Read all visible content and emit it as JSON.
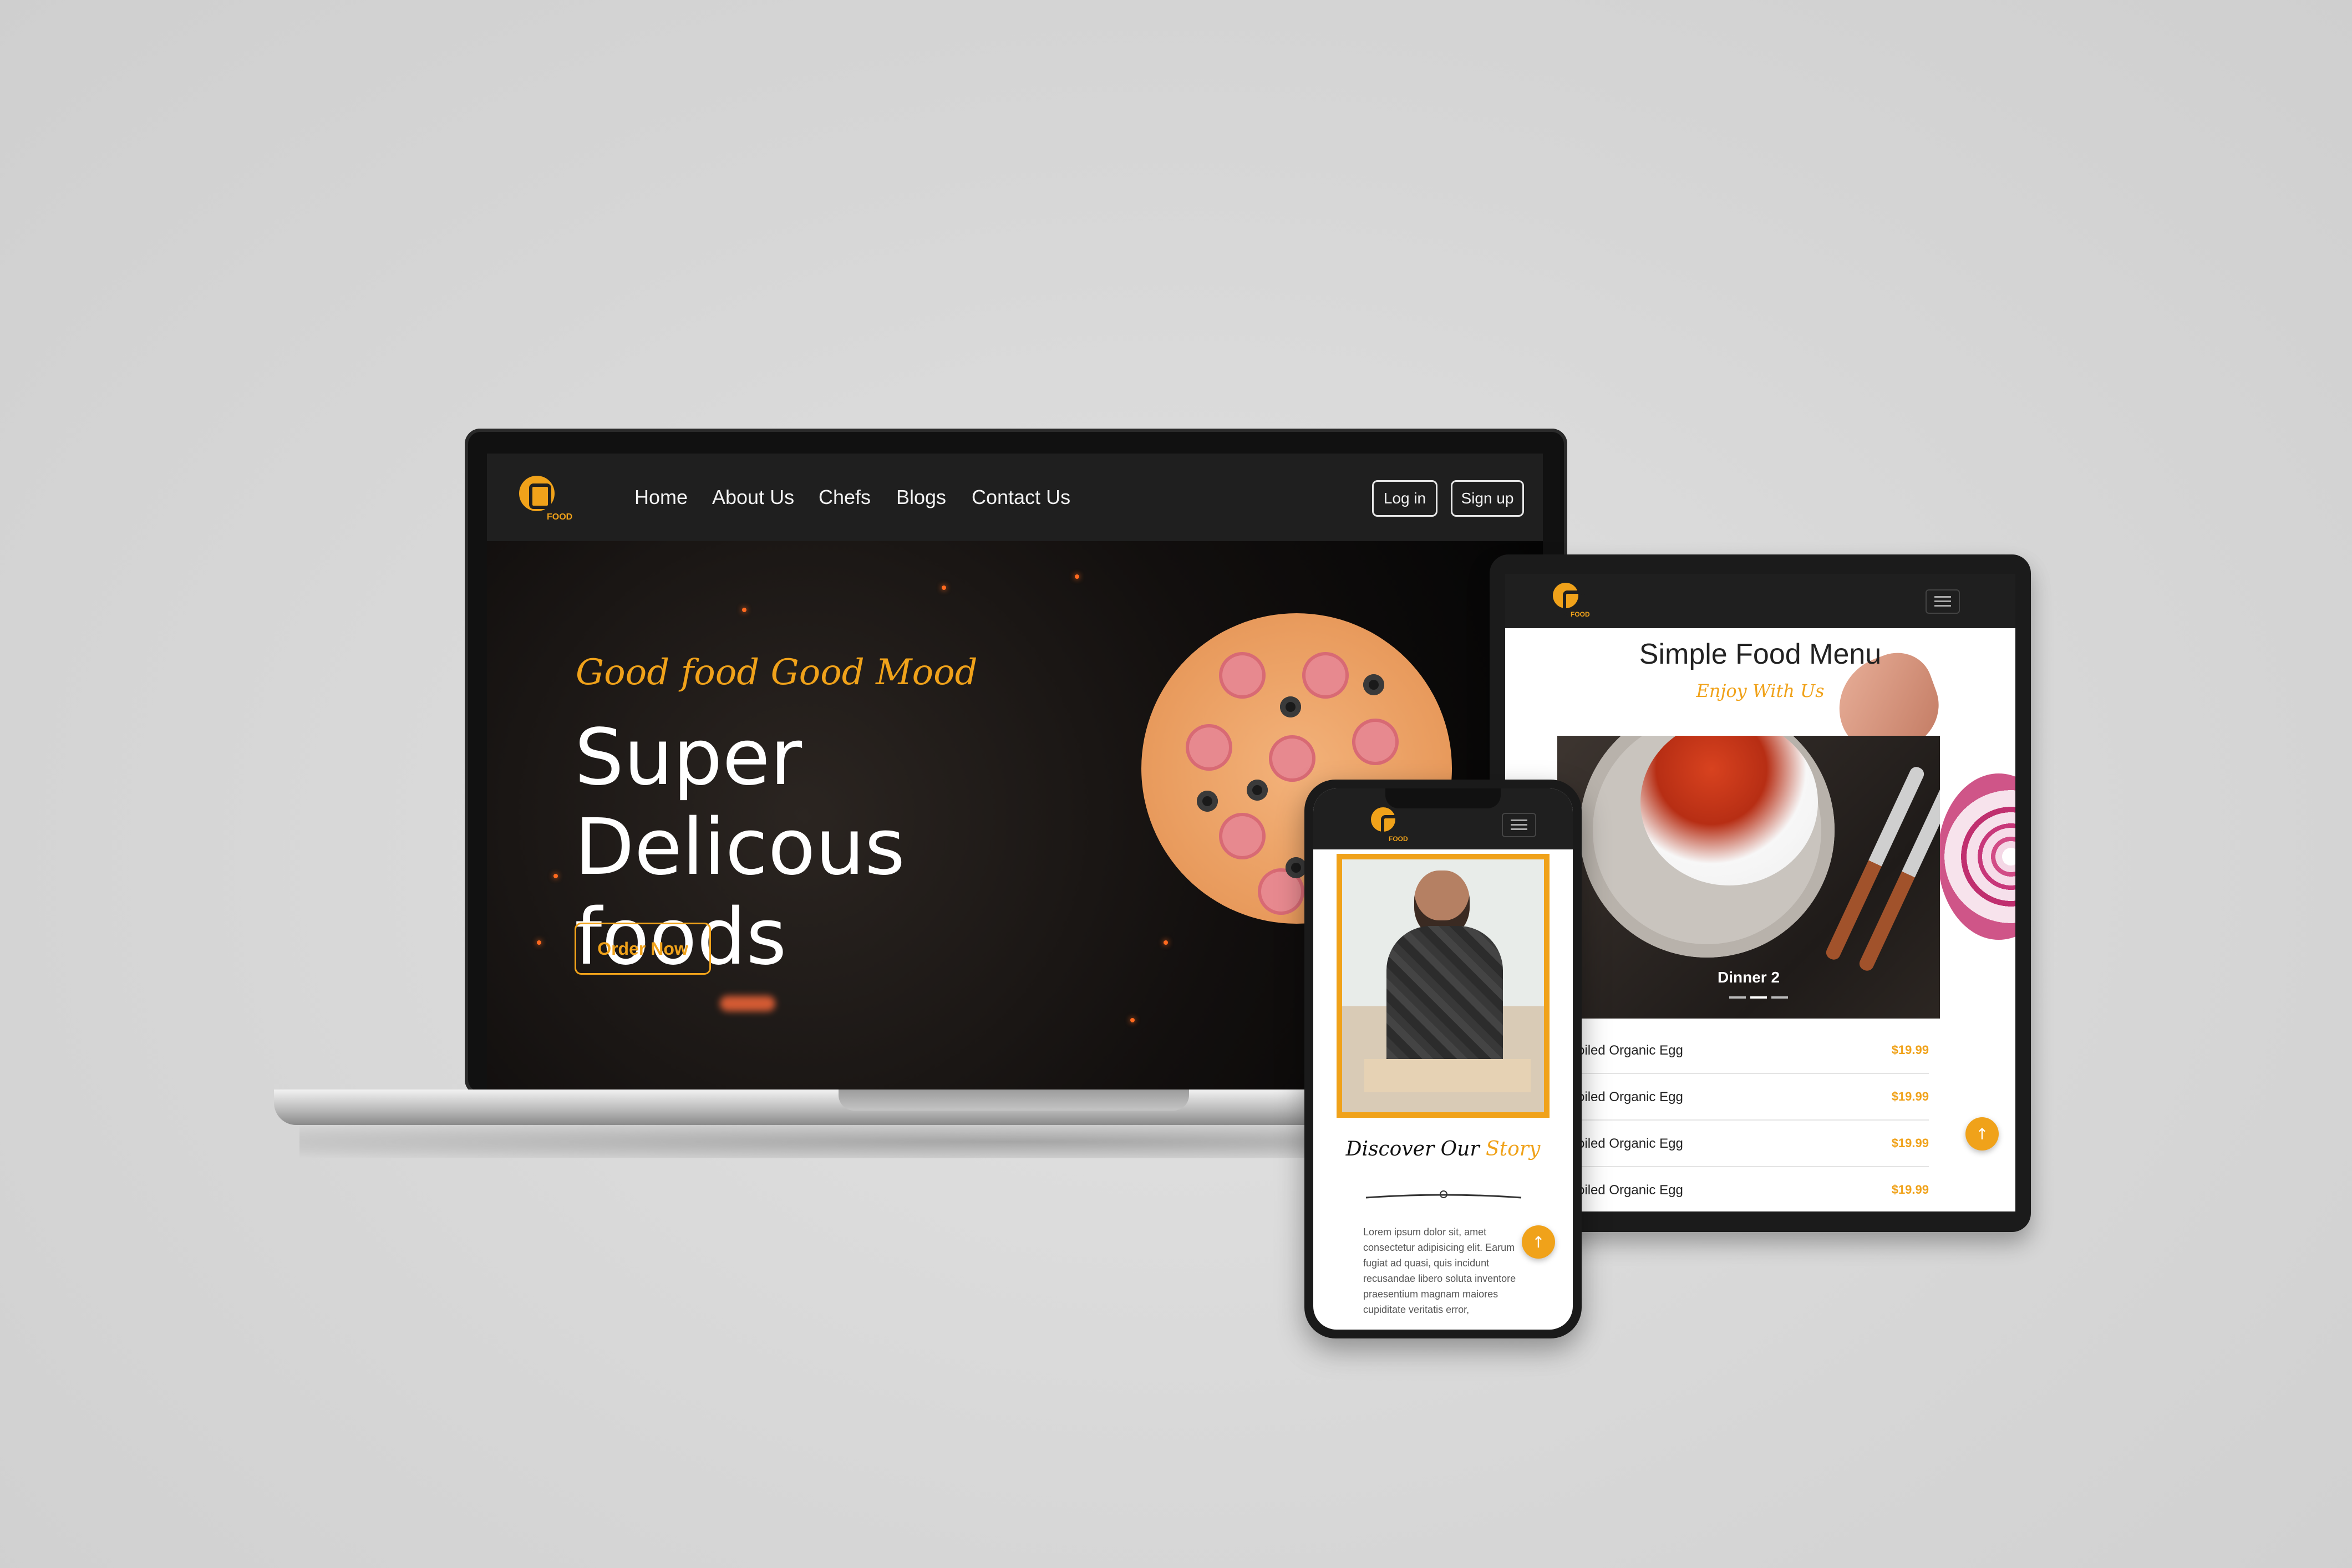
{
  "laptop": {
    "logo_text": "FOOD",
    "nav": [
      "Home",
      "About Us",
      "Chefs",
      "Blogs",
      "Contact Us"
    ],
    "login_label": "Log in",
    "signup_label": "Sign up",
    "tagline": "Good food Good Mood",
    "hero_title": "Super Delicous foods",
    "order_label": "Order Now"
  },
  "tablet": {
    "logo_text": "FOOD",
    "menu_title": "Simple Food Menu",
    "menu_subtitle": "Enjoy With Us",
    "slide_caption": "Dinner 2",
    "items": [
      {
        "name": "Boiled Organic Egg",
        "price": "$19.99"
      },
      {
        "name": "Boiled Organic Egg",
        "price": "$19.99"
      },
      {
        "name": "Boiled Organic Egg",
        "price": "$19.99"
      },
      {
        "name": "Boiled Organic Egg",
        "price": "$19.99"
      }
    ],
    "to_top_icon": "↑"
  },
  "phone": {
    "logo_text": "FOOD",
    "story_title_main": "Discover Our",
    "story_title_accent": "Story",
    "story_text": "Lorem ipsum dolor sit, amet consectetur adipisicing elit. Earum fugiat ad quasi, quis incidunt recusandae libero soluta inventore praesentium magnam maiores cupiditate veritatis error,",
    "to_top_icon": "↑"
  },
  "colors": {
    "accent": "#f0a21a",
    "nav_bg": "#1f1f1f"
  }
}
